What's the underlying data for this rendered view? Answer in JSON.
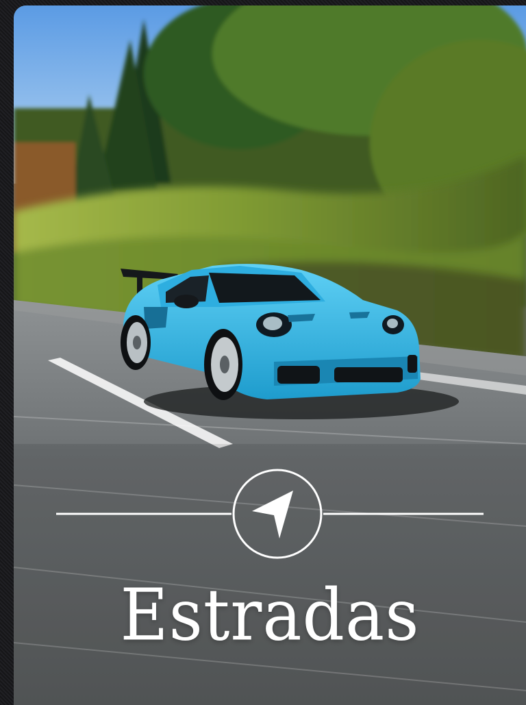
{
  "card": {
    "title": "Estradas",
    "emblem_icon": "navigation-arrow-icon"
  },
  "colors": {
    "car": "#2fb4e6",
    "sky": "#6fa9e6",
    "foliage": "#6f8a2c",
    "road": "#6d7173",
    "emblem": "#ffffff"
  }
}
